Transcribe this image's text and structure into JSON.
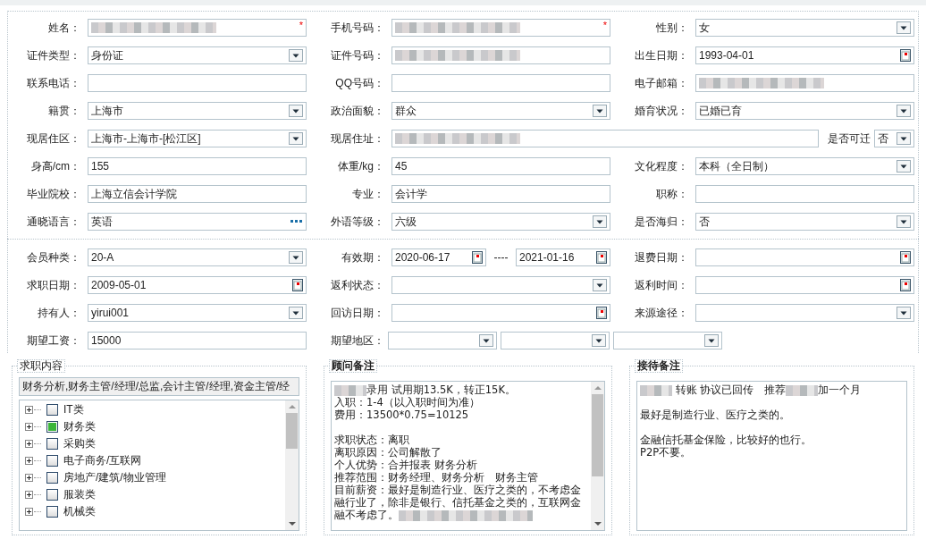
{
  "sections": [
    {
      "rows": [
        [
          {
            "label": "姓名：",
            "field": {
              "kind": "blurred",
              "required_mark": "*"
            }
          },
          {
            "label": "手机号码：",
            "field": {
              "kind": "blurred",
              "required_mark": "*"
            }
          },
          {
            "label": "性别：",
            "field": {
              "kind": "select",
              "value": "女"
            }
          }
        ],
        [
          {
            "label": "证件类型：",
            "field": {
              "kind": "select",
              "value": "身份证"
            }
          },
          {
            "label": "证件号码：",
            "field": {
              "kind": "blurred"
            }
          },
          {
            "label": "出生日期：",
            "field": {
              "kind": "date",
              "value": "1993-04-01"
            }
          }
        ],
        [
          {
            "label": "联系电话：",
            "field": {
              "kind": "text"
            }
          },
          {
            "label": "QQ号码：",
            "field": {
              "kind": "text"
            }
          },
          {
            "label": "电子邮箱：",
            "field": {
              "kind": "blurred"
            }
          }
        ],
        [
          {
            "label": "籍贯：",
            "field": {
              "kind": "select",
              "value": "上海市"
            }
          },
          {
            "label": "政治面貌：",
            "field": {
              "kind": "select",
              "value": "群众"
            }
          },
          {
            "label": "婚育状况：",
            "field": {
              "kind": "select",
              "value": "已婚已育"
            }
          }
        ],
        [
          {
            "label": "现居住区：",
            "field": {
              "kind": "select",
              "value": "上海市-上海市-[松江区]"
            }
          },
          {
            "label": "现居住址：",
            "field": {
              "kind": "blurred"
            },
            "extra": {
              "label": "是否可迁",
              "field": {
                "kind": "select",
                "value": "否"
              }
            }
          }
        ],
        [
          {
            "label": "身高/cm：",
            "field": {
              "kind": "text",
              "value": "155"
            }
          },
          {
            "label": "体重/kg：",
            "field": {
              "kind": "text",
              "value": "45"
            }
          },
          {
            "label": "文化程度：",
            "field": {
              "kind": "select",
              "value": "本科（全日制）"
            }
          }
        ],
        [
          {
            "label": "毕业院校：",
            "field": {
              "kind": "text",
              "value": "上海立信会计学院"
            }
          },
          {
            "label": "专业：",
            "field": {
              "kind": "text",
              "value": "会计学"
            }
          },
          {
            "label": "职称：",
            "field": {
              "kind": "text"
            }
          }
        ],
        [
          {
            "label": "通晓语言：",
            "field": {
              "kind": "lookup",
              "value": "英语"
            }
          },
          {
            "label": "外语等级：",
            "field": {
              "kind": "select",
              "value": "六级"
            }
          },
          {
            "label": "是否海归：",
            "field": {
              "kind": "select",
              "value": "否"
            }
          }
        ]
      ]
    },
    {
      "rows": [
        [
          {
            "label": "会员种类：",
            "field": {
              "kind": "select",
              "value": "20-A"
            }
          },
          {
            "label": "有效期：",
            "field": {
              "kind": "daterange",
              "from": "2020-06-17",
              "separator": "----",
              "to": "2021-01-16"
            }
          },
          {
            "label": "退费日期：",
            "field": {
              "kind": "date"
            }
          }
        ],
        [
          {
            "label": "求职日期：",
            "field": {
              "kind": "date",
              "value": "2009-05-01"
            }
          },
          {
            "label": "返利状态：",
            "field": {
              "kind": "select"
            }
          },
          {
            "label": "返利时间：",
            "field": {
              "kind": "date"
            }
          }
        ],
        [
          {
            "label": "持有人：",
            "field": {
              "kind": "select",
              "value": "yirui001"
            }
          },
          {
            "label": "回访日期：",
            "field": {
              "kind": "date"
            }
          },
          {
            "label": "来源途径：",
            "field": {
              "kind": "select"
            }
          }
        ],
        [
          {
            "label": "期望工资：",
            "field": {
              "kind": "text",
              "value": "15000"
            }
          },
          {
            "label": "期望地区：",
            "field": {
              "kind": "region",
              "parts": [
                {
                  "kind": "select"
                },
                {
                  "kind": "select"
                },
                {
                  "kind": "select"
                }
              ]
            }
          }
        ]
      ]
    }
  ],
  "job_content": {
    "legend": "求职内容",
    "summary": "财务分析,财务主管/经理/总监,会计主管/经理,资金主管/经",
    "tree": [
      {
        "label": "IT类",
        "checked": false
      },
      {
        "label": "财务类",
        "checked": true
      },
      {
        "label": "采购类",
        "checked": false
      },
      {
        "label": "电子商务/互联网",
        "checked": false
      },
      {
        "label": "房地产/建筑/物业管理",
        "checked": false
      },
      {
        "label": "服装类",
        "checked": false
      },
      {
        "label": "机械类",
        "checked": false
      }
    ]
  },
  "notes": [
    {
      "legend": "顾问备注",
      "scrollbar": true,
      "lines": [
        {
          "kind": "text",
          "parts": [
            {
              "kind": "blur"
            },
            {
              "kind": "text",
              "text": "录用 试用期13.5K，转正15K。"
            }
          ]
        },
        {
          "kind": "text",
          "parts": [
            {
              "kind": "text",
              "text": "入职：1-4（以入职时间为准）"
            }
          ]
        },
        {
          "kind": "text",
          "parts": [
            {
              "kind": "text",
              "text": "费用：13500*0.75=10125"
            }
          ]
        },
        {
          "kind": "blank"
        },
        {
          "kind": "text",
          "parts": [
            {
              "kind": "text",
              "text": "求职状态：离职"
            }
          ]
        },
        {
          "kind": "text",
          "parts": [
            {
              "kind": "text",
              "text": "离职原因：公司解散了"
            }
          ]
        },
        {
          "kind": "text",
          "parts": [
            {
              "kind": "text",
              "text": "个人优势：合并报表 财务分析"
            }
          ]
        },
        {
          "kind": "text",
          "parts": [
            {
              "kind": "text",
              "text": "推荐范围：财务经理、财务分析　财务主管"
            }
          ]
        },
        {
          "kind": "text",
          "parts": [
            {
              "kind": "text",
              "text": "目前薪资：最好是制造行业、医疗之类的，不考虑金"
            }
          ]
        },
        {
          "kind": "text",
          "parts": [
            {
              "kind": "text",
              "text": "融行业了，除非是银行、信托基金之类的，互联网金"
            }
          ]
        },
        {
          "kind": "text",
          "parts": [
            {
              "kind": "text",
              "text": "融不考虑了。"
            },
            {
              "kind": "blur",
              "wide": true
            }
          ]
        }
      ]
    },
    {
      "legend": "接待备注",
      "scrollbar": false,
      "lines": [
        {
          "kind": "text",
          "parts": [
            {
              "kind": "blur"
            },
            {
              "kind": "text",
              "text": " 转账 协议已回传　推荐"
            },
            {
              "kind": "blur"
            },
            {
              "kind": "text",
              "text": "加一个月"
            }
          ]
        },
        {
          "kind": "blank"
        },
        {
          "kind": "text",
          "parts": [
            {
              "kind": "text",
              "text": "最好是制造行业、医疗之类的。"
            }
          ]
        },
        {
          "kind": "blank"
        },
        {
          "kind": "text",
          "parts": [
            {
              "kind": "text",
              "text": "金融信托基金保险，比较好的也行。"
            }
          ]
        },
        {
          "kind": "text",
          "parts": [
            {
              "kind": "text",
              "text": "P2P不要。"
            }
          ]
        }
      ]
    }
  ]
}
